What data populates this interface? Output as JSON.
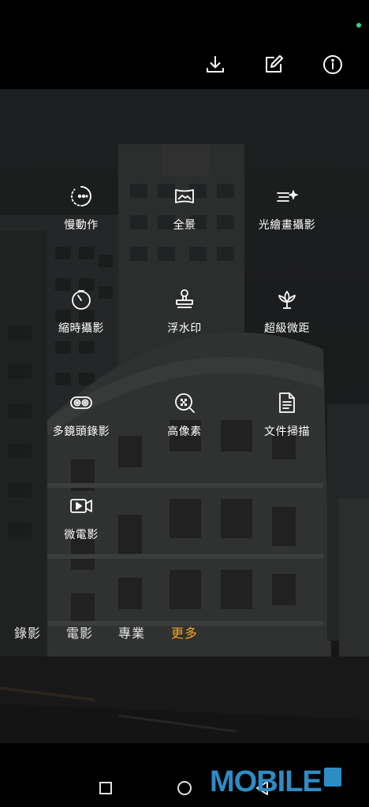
{
  "top_bar": {
    "icons": [
      {
        "name": "download-icon"
      },
      {
        "name": "edit-icon"
      },
      {
        "name": "info-icon"
      }
    ]
  },
  "modes": [
    {
      "id": "slow-motion",
      "label": "慢動作",
      "icon": "slow-motion-icon"
    },
    {
      "id": "panorama",
      "label": "全景",
      "icon": "panorama-icon"
    },
    {
      "id": "light-painting",
      "label": "光繪畫攝影",
      "icon": "light-painting-icon"
    },
    {
      "id": "time-lapse",
      "label": "縮時攝影",
      "icon": "time-lapse-icon"
    },
    {
      "id": "watermark",
      "label": "浮水印",
      "icon": "stamp-icon"
    },
    {
      "id": "super-macro",
      "label": "超級微距",
      "icon": "flower-icon"
    },
    {
      "id": "multi-lens",
      "label": "多鏡頭錄影",
      "icon": "multi-lens-icon"
    },
    {
      "id": "high-pixel",
      "label": "高像素",
      "icon": "high-pixel-icon"
    },
    {
      "id": "document-scan",
      "label": "文件掃描",
      "icon": "document-icon"
    },
    {
      "id": "micro-movie",
      "label": "微電影",
      "icon": "movie-camera-icon"
    }
  ],
  "tabs": [
    {
      "label": "錄影",
      "active": false
    },
    {
      "label": "電影",
      "active": false
    },
    {
      "label": "專業",
      "active": false
    },
    {
      "label": "更多",
      "active": true
    }
  ],
  "colors": {
    "active_tab": "#f5a623",
    "status_dot": "#37d37a",
    "watermark": "#2e8cc4"
  },
  "watermark": {
    "text": "MOBILE"
  }
}
